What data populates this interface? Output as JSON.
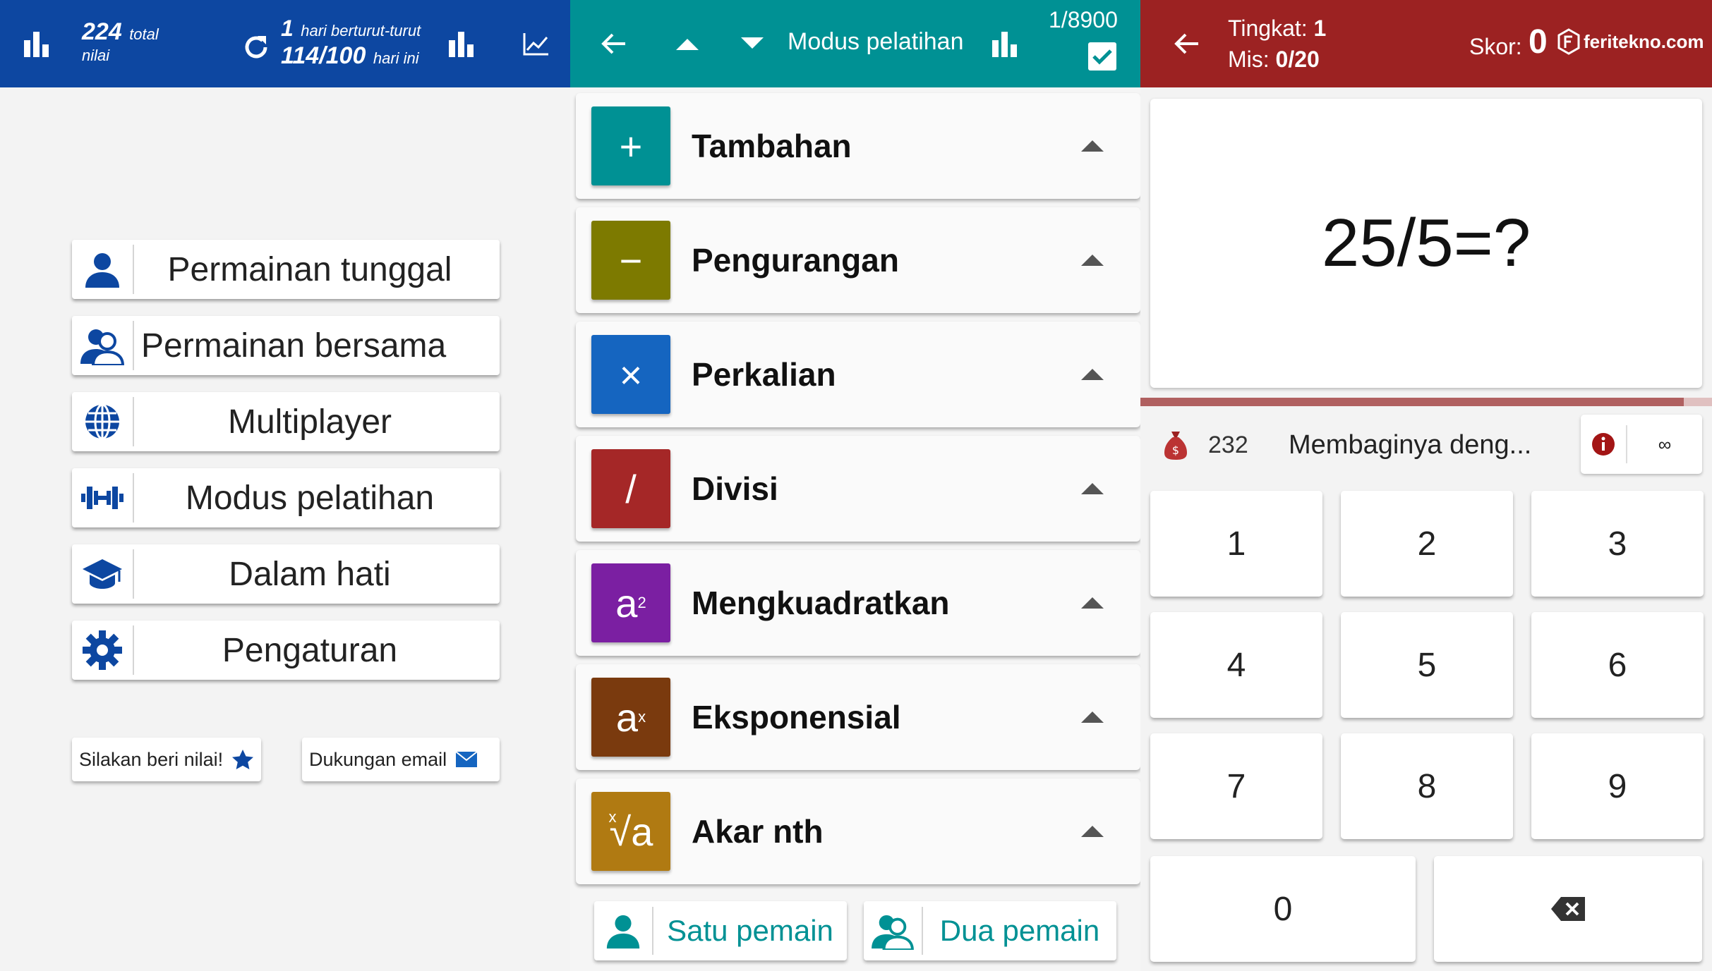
{
  "home": {
    "stats": {
      "total_num": "224",
      "total_word": "total",
      "nilai": "nilai",
      "streak_num": "1",
      "streak_label": "hari berturut-turut",
      "today_value": "114/100",
      "today_label": "hari ini"
    },
    "menu": [
      {
        "label": "Permainan tunggal",
        "icon": "person-icon"
      },
      {
        "label": "Permainan bersama",
        "icon": "people-icon"
      },
      {
        "label": "Multiplayer",
        "icon": "globe-icon"
      },
      {
        "label": "Modus pelatihan",
        "icon": "dumbbell-icon"
      },
      {
        "label": "Dalam hati",
        "icon": "graduation-cap-icon"
      },
      {
        "label": "Pengaturan",
        "icon": "gear-icon"
      }
    ],
    "rate_label": "Silakan beri nilai!",
    "email_label": "Dukungan email"
  },
  "training": {
    "title": "Modus pelatihan",
    "counter": "1/8900",
    "categories": [
      {
        "name": "Tambahan",
        "symbol": "+",
        "color": "#009194"
      },
      {
        "name": "Pengurangan",
        "symbol": "−",
        "color": "#7d7a00"
      },
      {
        "name": "Perkalian",
        "symbol": "×",
        "color": "#1565c0"
      },
      {
        "name": "Divisi",
        "symbol": "/",
        "color": "#a52727"
      },
      {
        "name": "Mengkuadratkan",
        "symbol": "a",
        "sup": "2",
        "color": "#7b1fa2"
      },
      {
        "name": "Eksponensial",
        "symbol": "a",
        "sup": "x",
        "color": "#7a3a0e"
      },
      {
        "name": "Akar nth",
        "symbol": "√a",
        "sup": "x",
        "color": "#b07a12"
      }
    ],
    "one_player": "Satu pemain",
    "two_player": "Dua pemain"
  },
  "game": {
    "level_label": "Tingkat:",
    "level_value": "1",
    "miss_label": "Mis:",
    "miss_value": "0/20",
    "score_label": "Skor:",
    "score_value": "0",
    "watermark": "feritekno.com",
    "question": "25/5=?",
    "progress": 0.95,
    "coins": "232",
    "hint_text": "Membaginya deng...",
    "infinity": "∞",
    "keys": [
      "1",
      "2",
      "3",
      "4",
      "5",
      "6",
      "7",
      "8",
      "9"
    ],
    "zero": "0",
    "colors": {
      "accent": "#9c2222"
    }
  }
}
